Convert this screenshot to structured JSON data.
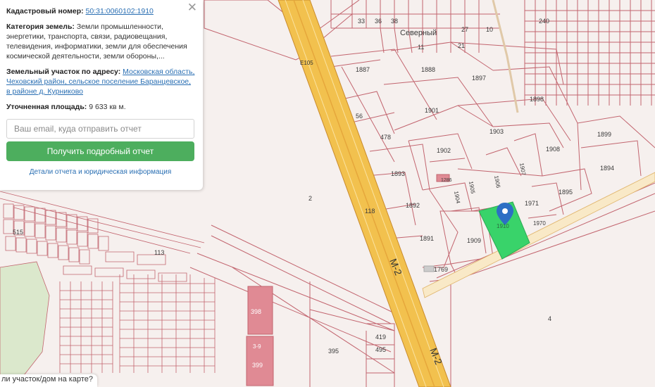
{
  "panel": {
    "close_label": "✕",
    "cadastral_label": "Кадастровый номер:",
    "cadastral_value": "50:31:0060102:1910",
    "category_label": "Категория земель:",
    "category_value": "Земли промышленности, энергетики, транспорта, связи, радиовещания, телевидения, информатики, земли для обеспечения космической деятельности, земли обороны,...",
    "address_label": "Земельный участок по адресу:",
    "address_value": "Московская область, Чеховский район, сельское поселение Баранцевское, в районе д. Курниково",
    "area_label": "Уточненная площадь:",
    "area_value": "9 633 кв м.",
    "email_placeholder": "Ваш email, куда отправить отчет",
    "report_button": "Получить подробный отчет",
    "details_link": "Детали отчета и юридическая информация"
  },
  "bottom_question": "ли участок/дом на карте?",
  "map": {
    "village_label": "Северный",
    "road_e105": "E105",
    "road_m2": "М-2",
    "parcels": [
      "1887",
      "1888",
      "1897",
      "1898",
      "1901",
      "1903",
      "1899",
      "56",
      "478",
      "1902",
      "1908",
      "1893",
      "1286",
      "1906",
      "1907",
      "1894",
      "1905",
      "1904",
      "1895",
      "1892",
      "1971",
      "118",
      "1891",
      "1909",
      "1910",
      "1970",
      "1769",
      "2",
      "4",
      "398",
      "3-9",
      "399",
      "395",
      "419",
      "495",
      "113",
      "515",
      "27",
      "10",
      "21",
      "11",
      "33",
      "36",
      "38",
      "240"
    ],
    "colors": {
      "background": "#f6f0ee",
      "parcel_line": "#c2646e",
      "road_fill": "#f2c14e",
      "road_edge": "#c98a2c",
      "selected_parcel": "#39d36a",
      "pin": "#2d6fc4",
      "building": "#e08a94",
      "green_area": "#dbe8cc"
    }
  }
}
